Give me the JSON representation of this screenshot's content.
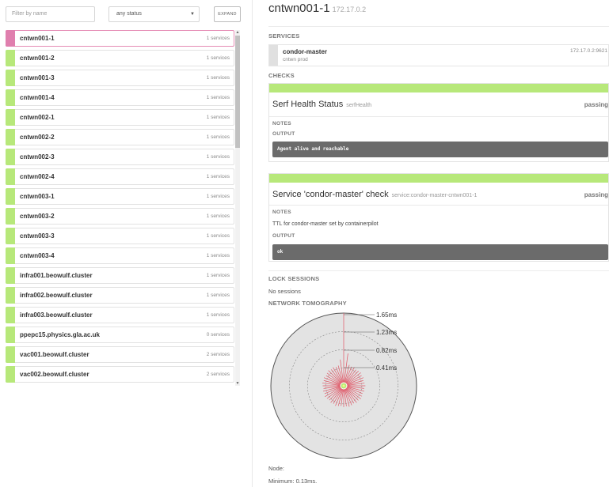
{
  "filters": {
    "search_placeholder": "Filter by name",
    "status_value": "any status",
    "expand_label": "EXPAND"
  },
  "nodes": [
    {
      "name": "cntwn001-1",
      "services": "1 services",
      "selected": true
    },
    {
      "name": "cntwn001-2",
      "services": "1 services"
    },
    {
      "name": "cntwn001-3",
      "services": "1 services"
    },
    {
      "name": "cntwn001-4",
      "services": "1 services"
    },
    {
      "name": "cntwn002-1",
      "services": "1 services"
    },
    {
      "name": "cntwn002-2",
      "services": "1 services"
    },
    {
      "name": "cntwn002-3",
      "services": "1 services"
    },
    {
      "name": "cntwn002-4",
      "services": "1 services"
    },
    {
      "name": "cntwn003-1",
      "services": "1 services"
    },
    {
      "name": "cntwn003-2",
      "services": "1 services"
    },
    {
      "name": "cntwn003-3",
      "services": "1 services"
    },
    {
      "name": "cntwn003-4",
      "services": "1 services"
    },
    {
      "name": "infra001.beowulf.cluster",
      "services": "1 services"
    },
    {
      "name": "infra002.beowulf.cluster",
      "services": "1 services"
    },
    {
      "name": "infra003.beowulf.cluster",
      "services": "1 services"
    },
    {
      "name": "ppepc15.physics.gla.ac.uk",
      "services": "0 services"
    },
    {
      "name": "vac001.beowulf.cluster",
      "services": "2 services"
    },
    {
      "name": "vac002.beowulf.cluster",
      "services": "2 services"
    }
  ],
  "detail": {
    "node_name": "cntwn001-1",
    "node_ip": "172.17.0.2",
    "services_title": "SERVICES",
    "service": {
      "name": "condor-master",
      "tags": "cntwn prod",
      "address": "172.17.0.2:9621"
    },
    "checks_title": "CHECKS",
    "checks": [
      {
        "name": "Serf Health Status",
        "id": "serfHealth",
        "status": "passing",
        "notes_label": "NOTES",
        "notes": "",
        "output_label": "OUTPUT",
        "output": "Agent alive and reachable"
      },
      {
        "name": "Service 'condor-master' check",
        "id": "service:condor-master-cntwn001-1",
        "status": "passing",
        "notes_label": "NOTES",
        "notes": "TTL for condor-master set by containerpilot",
        "output_label": "OUTPUT",
        "output": "ok"
      }
    ],
    "lock_sessions_title": "LOCK SESSIONS",
    "lock_sessions_text": "No sessions",
    "tomography_title": "NETWORK TOMOGRAPHY",
    "tomography": {
      "ring_labels": [
        "1.65ms",
        "1.23ms",
        "0.82ms",
        "0.41ms"
      ],
      "ring_values_ms": [
        1.65,
        1.23,
        0.82,
        0.41
      ],
      "node_label": "Node:",
      "minimum_label": "Minimum: 0.13ms."
    }
  },
  "colors": {
    "passing_green": "#b7e87a",
    "selected_pink": "#e07fae",
    "latency_red": "#e05565",
    "output_bg": "#6b6b6b"
  }
}
